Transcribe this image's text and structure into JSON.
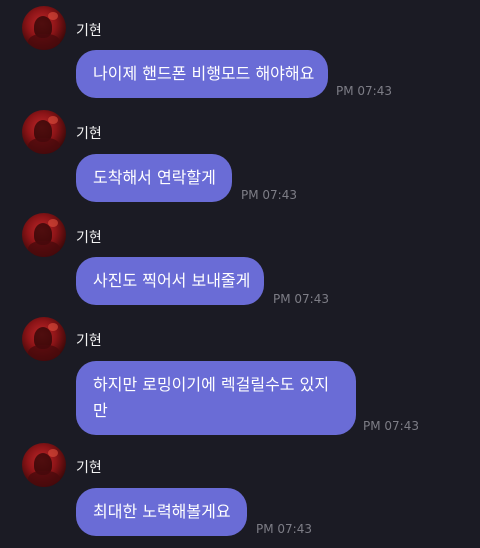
{
  "chat": {
    "messages": [
      {
        "sender": "기현",
        "text": "나이제 핸드폰 비행모드 해야해요",
        "time": "PM 07:43"
      },
      {
        "sender": "기현",
        "text": "도착해서 연락할게",
        "time": "PM 07:43"
      },
      {
        "sender": "기현",
        "text": "사진도 찍어서 보내줄게",
        "time": "PM 07:43"
      },
      {
        "sender": "기현",
        "text": "하지만 로밍이기에 렉걸릴수도 있지 만",
        "time": "PM 07:43"
      },
      {
        "sender": "기현",
        "text": "최대한 노력해볼게요",
        "time": "PM 07:43"
      }
    ]
  },
  "colors": {
    "background": "#1b1b24",
    "bubble": "#6a6cd6",
    "sender_name": "#f2f2f2",
    "timestamp": "#7d7d86"
  },
  "icons": {
    "avatar": "profile-avatar"
  }
}
